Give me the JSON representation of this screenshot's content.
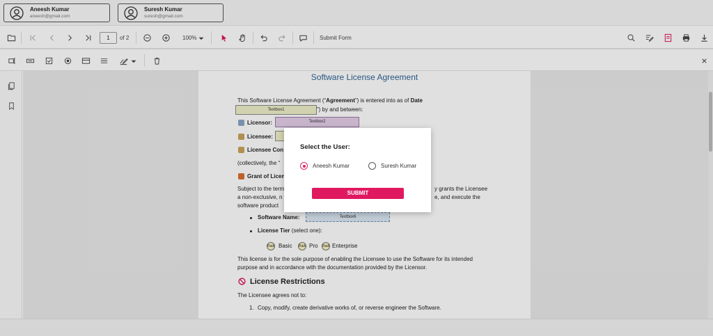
{
  "users": [
    {
      "name": "Aneesh Kumar",
      "email": "aneesh@gmail.com"
    },
    {
      "name": "Suresh Kumar",
      "email": "suresh@gmail.com"
    }
  ],
  "toolbar": {
    "page_number": "1",
    "page_total": "of 2",
    "zoom": "100%",
    "submit_form": "Submit Form"
  },
  "document": {
    "title": "Software License Agreement",
    "intro_1": "This Software License Agreement (“",
    "intro_agreement": "Agreement",
    "intro_2": "”) is entered into as of ",
    "intro_date": "Date",
    "intro_3": "”) by and between:",
    "licensor_label": "Licensor:",
    "licensee_label": "Licensee:",
    "licensee_contact_label": "Licensee Con",
    "collectively": "(collectively, the “",
    "grant_label": "Grant of Licen",
    "subject_1": "Subject to the term",
    "subject_1b": "y grants the Licensee",
    "subject_2": "a non-exclusive, n",
    "subject_2b": "e, and execute the",
    "subject_3": "software product",
    "software_name_label": "Software Name:",
    "license_tier_label": "License Tier",
    "license_tier_hint": " (select one):",
    "tier_basic": "Basic",
    "tier_pro": "Pro",
    "tier_enterprise": "Enterprise",
    "radio_badge": "Radi",
    "purpose_1": "This license is for the sole purpose of enabling the Licensee to use the Software for its intended",
    "purpose_2": "purpose and in accordance with the documentation provided by the Licensor.",
    "restrictions_heading": "License Restrictions",
    "agrees_not": "The Licensee agrees not to:",
    "restriction_1_num": "1.",
    "restriction_1": "Copy, modify, create derivative works of, or reverse engineer the Software.",
    "field_textbox1": "Textbox1",
    "field_textbox2": "Textbox2",
    "field_textbox6": "Textbox6"
  },
  "modal": {
    "title": "Select the User:",
    "options": [
      "Aneesh Kumar",
      "Suresh Kumar"
    ],
    "selected": "Aneesh Kumar",
    "submit_label": "SUBMIT"
  },
  "colors": {
    "accent": "#e0185f",
    "title_blue": "#2f6493"
  }
}
